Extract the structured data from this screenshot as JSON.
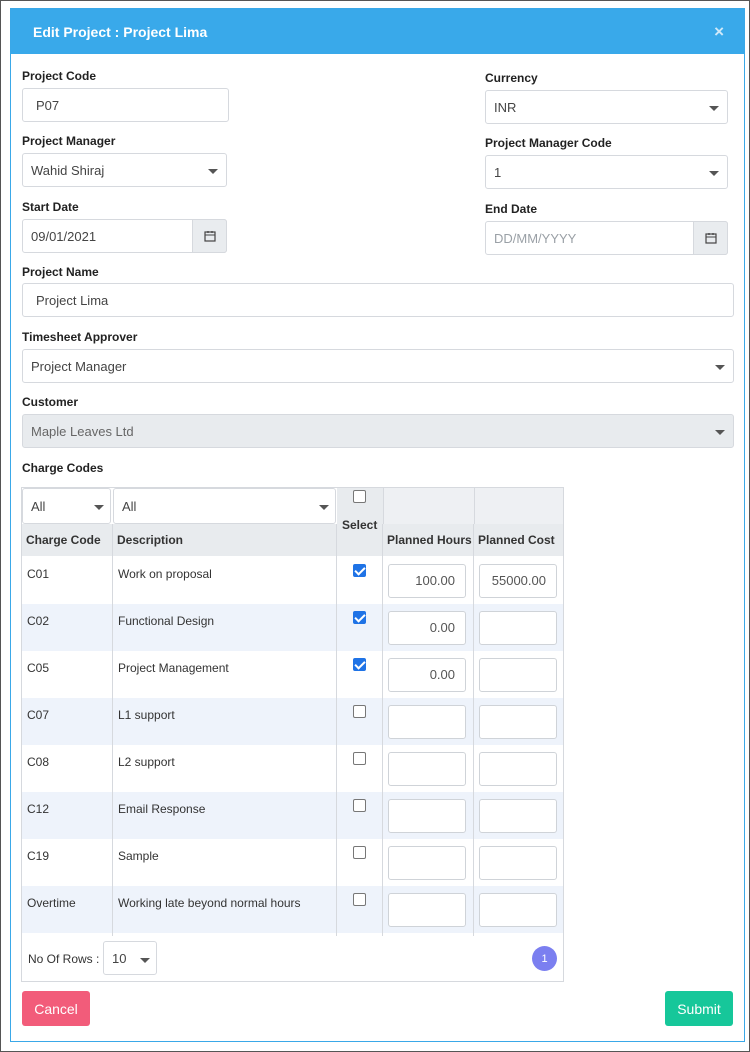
{
  "modal": {
    "title": "Edit Project :  Project Lima",
    "close_label": "×"
  },
  "form": {
    "project_code_label": "Project Code",
    "project_code_value": "P07",
    "currency_label": "Currency",
    "currency_value": "INR",
    "project_manager_label": "Project Manager",
    "project_manager_value": "Wahid Shiraj",
    "pm_code_label": "Project Manager Code",
    "pm_code_value": "1",
    "start_date_label": "Start Date",
    "start_date_value": "09/01/2021",
    "end_date_label": "End Date",
    "end_date_placeholder": "DD/MM/YYYY",
    "project_name_label": "Project Name",
    "project_name_value": "Project Lima",
    "timesheet_approver_label": "Timesheet Approver",
    "timesheet_approver_value": "Project Manager",
    "customer_label": "Customer",
    "customer_value": "Maple Leaves Ltd",
    "charge_codes_label": "Charge Codes"
  },
  "table": {
    "filter_code": "All",
    "filter_desc": "All",
    "select_label": "Select",
    "headers": {
      "code": "Charge Code",
      "description": "Description",
      "hours": "Planned Hours",
      "cost": "Planned Cost"
    },
    "rows": [
      {
        "code": "C01",
        "description": "Work on proposal",
        "selected": true,
        "hours": "100.00",
        "cost": "55000.00"
      },
      {
        "code": "C02",
        "description": "Functional Design",
        "selected": true,
        "hours": "0.00",
        "cost": ""
      },
      {
        "code": "C05",
        "description": "Project Management",
        "selected": true,
        "hours": "0.00",
        "cost": ""
      },
      {
        "code": "C07",
        "description": "L1 support",
        "selected": false,
        "hours": "",
        "cost": ""
      },
      {
        "code": "C08",
        "description": "L2 support",
        "selected": false,
        "hours": "",
        "cost": ""
      },
      {
        "code": "C12",
        "description": "Email Response",
        "selected": false,
        "hours": "",
        "cost": ""
      },
      {
        "code": "C19",
        "description": "Sample",
        "selected": false,
        "hours": "",
        "cost": ""
      },
      {
        "code": "Overtime",
        "description": "Working late beyond normal hours",
        "selected": false,
        "hours": "",
        "cost": ""
      }
    ],
    "rows_label": "No Of Rows :",
    "rows_value": "10",
    "page_number": "1"
  },
  "buttons": {
    "cancel": "Cancel",
    "submit": "Submit"
  },
  "colors": {
    "header": "#39a9ea",
    "cancel": "#f25c7a",
    "submit": "#16c79a",
    "page_badge": "#7b7ff0",
    "checkbox": "#1f73e6"
  }
}
